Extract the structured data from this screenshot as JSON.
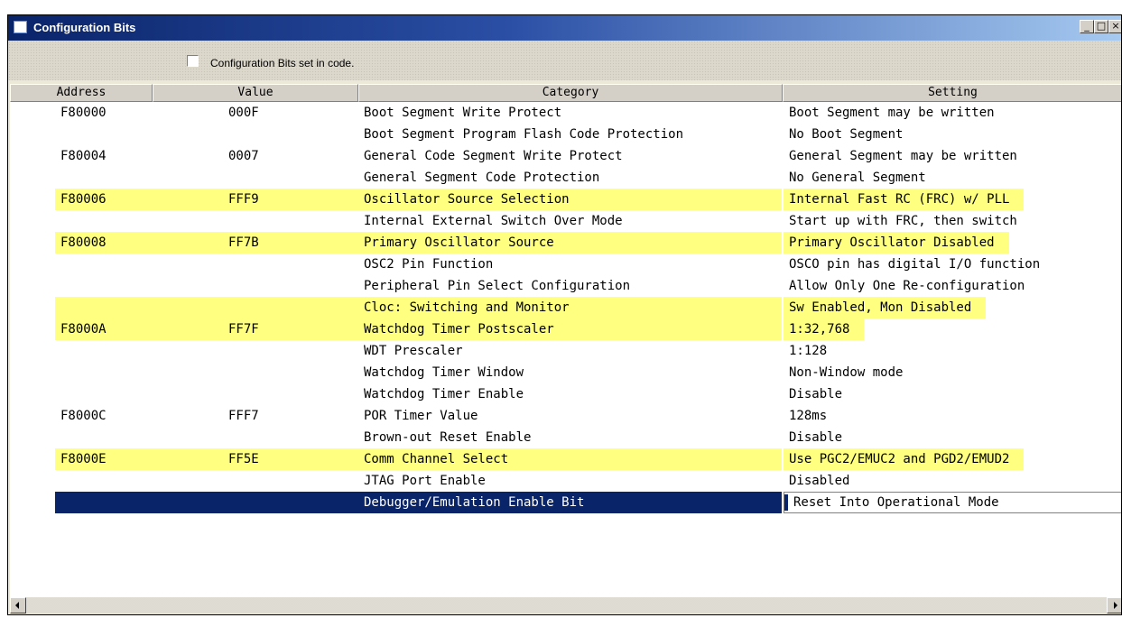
{
  "window": {
    "title": "Configuration Bits"
  },
  "toolbar": {
    "checkbox_label": "Configuration Bits set in code.",
    "checkbox_checked": false
  },
  "columns": [
    "Address",
    "Value",
    "Category",
    "Setting"
  ],
  "rows": [
    {
      "address": "F80000",
      "value": "000F",
      "category": "Boot Segment Write Protect",
      "setting": "Boot Segment may be written",
      "highlight": false
    },
    {
      "address": "",
      "value": "",
      "category": "Boot Segment Program Flash Code Protection",
      "setting": "No Boot Segment",
      "highlight": false
    },
    {
      "address": "F80004",
      "value": "0007",
      "category": "General Code Segment Write Protect",
      "setting": "General Segment may be written",
      "highlight": false
    },
    {
      "address": "",
      "value": "",
      "category": "General Segment Code Protection",
      "setting": "No General Segment",
      "highlight": false
    },
    {
      "address": "F80006",
      "value": "FFF9",
      "category": "Oscillator Source Selection",
      "setting": "Internal Fast RC (FRC) w/ PLL",
      "highlight": true
    },
    {
      "address": "",
      "value": "",
      "category": "Internal External Switch Over Mode",
      "setting": "Start up with FRC, then switch",
      "highlight": false
    },
    {
      "address": "F80008",
      "value": "FF7B",
      "category": "Primary Oscillator Source",
      "setting": "Primary Oscillator Disabled",
      "highlight": true
    },
    {
      "address": "",
      "value": "",
      "category": "OSC2 Pin Function",
      "setting": "OSCO pin has digital I/O function",
      "highlight": false
    },
    {
      "address": "",
      "value": "",
      "category": "Peripheral Pin Select Configuration",
      "setting": "Allow Only One Re-configuration",
      "highlight": false
    },
    {
      "address": "",
      "value": "",
      "category": "Cloc: Switching and Monitor",
      "setting": "Sw Enabled, Mon Disabled",
      "highlight": true,
      "partial": true
    },
    {
      "address": "F8000A",
      "value": "FF7F",
      "category": "Watchdog Timer Postscaler",
      "setting": "1:32,768",
      "highlight": true
    },
    {
      "address": "",
      "value": "",
      "category": "WDT Prescaler",
      "setting": "1:128",
      "highlight": false
    },
    {
      "address": "",
      "value": "",
      "category": "Watchdog Timer Window",
      "setting": "Non-Window mode",
      "highlight": false
    },
    {
      "address": "",
      "value": "",
      "category": "Watchdog Timer Enable",
      "setting": "Disable",
      "highlight": false
    },
    {
      "address": "F8000C",
      "value": "FFF7",
      "category": "POR Timer Value",
      "setting": "128ms",
      "highlight": false
    },
    {
      "address": "",
      "value": "",
      "category": "Brown-out Reset Enable",
      "setting": "Disable",
      "highlight": false
    },
    {
      "address": "F8000E",
      "value": "FF5E",
      "category": "Comm Channel Select",
      "setting": "Use PGC2/EMUC2 and PGD2/EMUD2",
      "highlight": true
    },
    {
      "address": "",
      "value": "",
      "category": "JTAG Port Enable",
      "setting": "Disabled",
      "highlight": false
    },
    {
      "address": "",
      "value": "",
      "category": "Debugger/Emulation Enable Bit",
      "setting": "Reset Into Operational Mode",
      "highlight": false,
      "selected": true
    }
  ],
  "colors": {
    "highlight": "#ffff80",
    "selection": "#0a246a"
  }
}
